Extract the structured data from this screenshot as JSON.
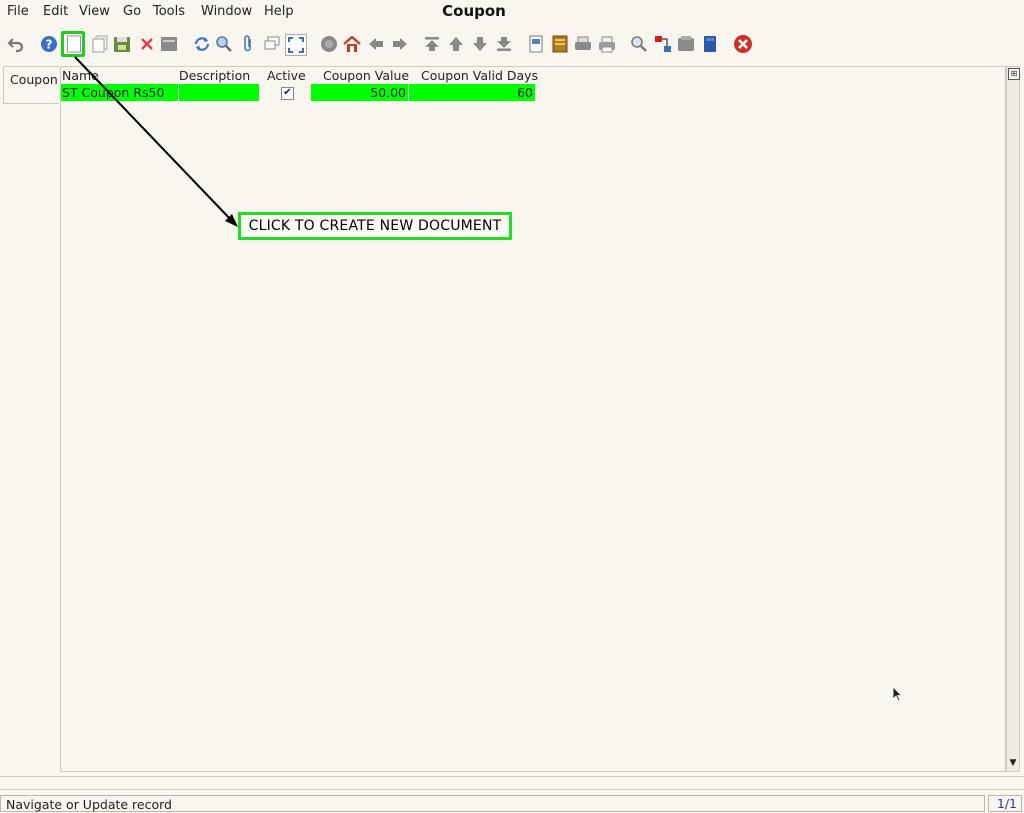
{
  "window": {
    "title": "Coupon"
  },
  "menu": [
    {
      "label": "File"
    },
    {
      "label": "Edit"
    },
    {
      "label": "View"
    },
    {
      "label": "Go"
    },
    {
      "label": "Tools"
    },
    {
      "label": "Window"
    },
    {
      "label": "Help"
    }
  ],
  "left_tab": {
    "label": "Coupon"
  },
  "grid": {
    "columns": [
      "Name",
      "Description",
      "Active",
      "Coupon Value",
      "Coupon Valid Days"
    ],
    "rows": [
      {
        "name": "ST Coupon Rs50",
        "description": "",
        "active": "✔",
        "coupon_value": "50.00",
        "valid_days": "60"
      }
    ]
  },
  "annotation": {
    "text": "CLICK TO CREATE NEW DOCUMENT"
  },
  "status": {
    "message": "Navigate or Update record",
    "record_count": "1/1"
  },
  "colors": {
    "row_highlight": "#00ff00",
    "annotation_border": "#22dd22",
    "background": "#f8f6ee"
  }
}
